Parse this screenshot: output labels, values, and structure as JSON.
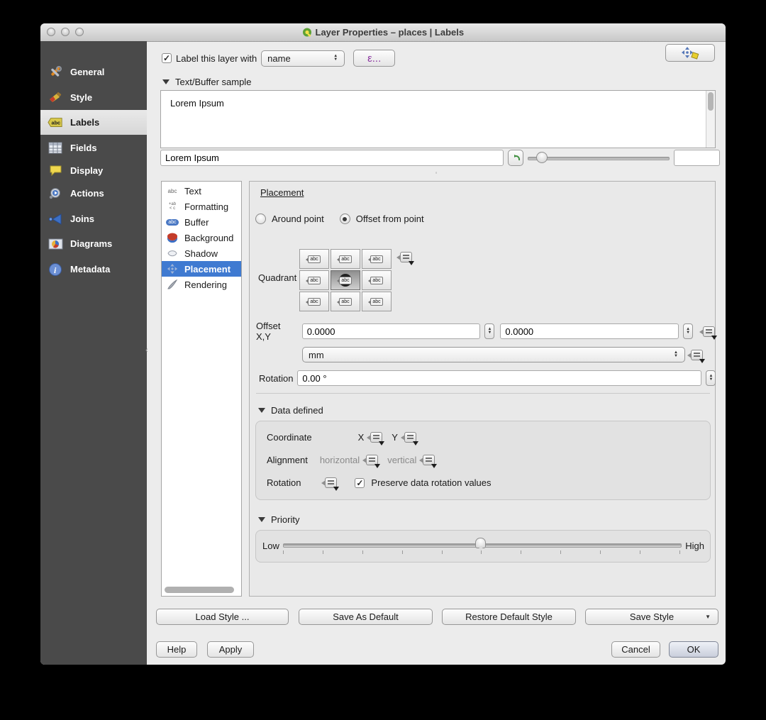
{
  "window": {
    "title": "Layer Properties – places | Labels"
  },
  "sidebar": {
    "selected": "Labels",
    "items": [
      {
        "label": "General",
        "icon": "tools-icon"
      },
      {
        "label": "Style",
        "icon": "paintbrush-icon"
      },
      {
        "label": "Labels",
        "icon": "abc-tag-icon"
      },
      {
        "label": "Fields",
        "icon": "table-icon"
      },
      {
        "label": "Display",
        "icon": "speech-bubble-icon"
      },
      {
        "label": "Actions",
        "icon": "gear-icon"
      },
      {
        "label": "Joins",
        "icon": "join-arrow-icon"
      },
      {
        "label": "Diagrams",
        "icon": "chart-icon"
      },
      {
        "label": "Metadata",
        "icon": "info-icon"
      }
    ]
  },
  "header": {
    "checkbox_label": "Label this layer with",
    "checkbox_checked": true,
    "field_value": "name",
    "expression_button_label": "ε...",
    "auto_placement_icon": "move-arrows-icon"
  },
  "sample": {
    "section_title": "Text/Buffer sample",
    "preview_text": "Lorem Ipsum",
    "input_value": "Lorem Ipsum"
  },
  "tabs": {
    "selected": "Placement",
    "items": [
      {
        "label": "Text",
        "icon": "abc-text-icon"
      },
      {
        "label": "Formatting",
        "icon": "formatting-icon"
      },
      {
        "label": "Buffer",
        "icon": "abc-badge-icon"
      },
      {
        "label": "Background",
        "icon": "background-shape-icon"
      },
      {
        "label": "Shadow",
        "icon": "shadow-blob-icon"
      },
      {
        "label": "Placement",
        "icon": "move-arrows-icon"
      },
      {
        "label": "Rendering",
        "icon": "brush-stroke-icon"
      }
    ]
  },
  "placement": {
    "title": "Placement",
    "radio_around": "Around point",
    "radio_offset": "Offset from point",
    "selected_radio": "Offset from point",
    "quadrant": {
      "label": "Quadrant",
      "icon_text": "abc",
      "selected_index": 4
    },
    "offset_label": "Offset X,Y",
    "offset_x": "0.0000",
    "offset_y": "0.0000",
    "unit_value": "mm",
    "rotation_label": "Rotation",
    "rotation_value": "0.00 °"
  },
  "data_defined": {
    "section_title": "Data defined",
    "coordinate_label": "Coordinate",
    "x_label": "X",
    "y_label": "Y",
    "alignment_label": "Alignment",
    "horizontal_label": "horizontal",
    "vertical_label": "vertical",
    "rotation_label": "Rotation",
    "preserve_label": "Preserve data rotation values",
    "preserve_checked": true
  },
  "priority": {
    "section_title": "Priority",
    "low_label": "Low",
    "high_label": "High",
    "slider_position": 0.49
  },
  "style_buttons": {
    "load": "Load Style ...",
    "save_default": "Save As Default",
    "restore": "Restore Default Style",
    "save_style": "Save Style"
  },
  "action_buttons": {
    "help": "Help",
    "apply": "Apply",
    "cancel": "Cancel",
    "ok": "OK"
  },
  "colors": {
    "selection_blue": "#3f7ad1",
    "sidebar_bg": "#4a4a4a",
    "label_tag_yellow": "#d8c84a",
    "expression_purple": "#8b35a0",
    "undo_green": "#3f8f3f"
  }
}
